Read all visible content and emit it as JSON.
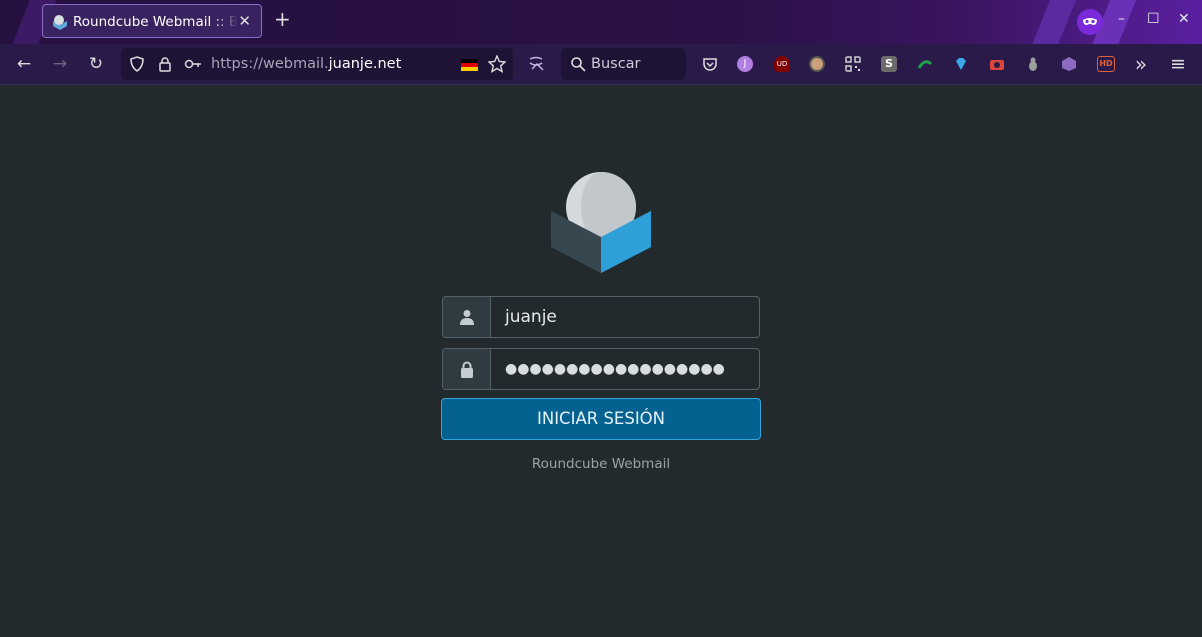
{
  "browser": {
    "tab_title": "Roundcube Webmail :: Bienvenido a Roundcube Webmail",
    "tab_close": "✕",
    "new_tab": "+",
    "url_prefix": "https://webmail.",
    "url_domain": "juanje.net",
    "search_placeholder": "Buscar",
    "window_controls": {
      "minimize": "–",
      "maximize": "☐",
      "close": "✕"
    },
    "extensions": [
      "pocket-icon",
      "j-avatar-icon",
      "ublock-icon",
      "meerkat-icon",
      "qr-code-icon",
      "s-icon",
      "green-wave-icon",
      "gem-icon",
      "camera-icon",
      "bug-icon",
      "cube-icon",
      "hd-icon"
    ],
    "extension_labels": {
      "j": "J",
      "ublock": "UD",
      "s": "S",
      "hd": "HD"
    },
    "overflow": "»",
    "menu": "≡"
  },
  "login": {
    "username_value": "juanje",
    "password_mask": "●●●●●●●●●●●●●●●●●●",
    "submit_label": "INICIAR SESIÓN",
    "footer_text": "Roundcube Webmail"
  },
  "colors": {
    "page_bg": "#222a2e",
    "button_bg": "#05618f",
    "button_border": "#37a3d8",
    "tab_border": "#8a6cc9"
  }
}
